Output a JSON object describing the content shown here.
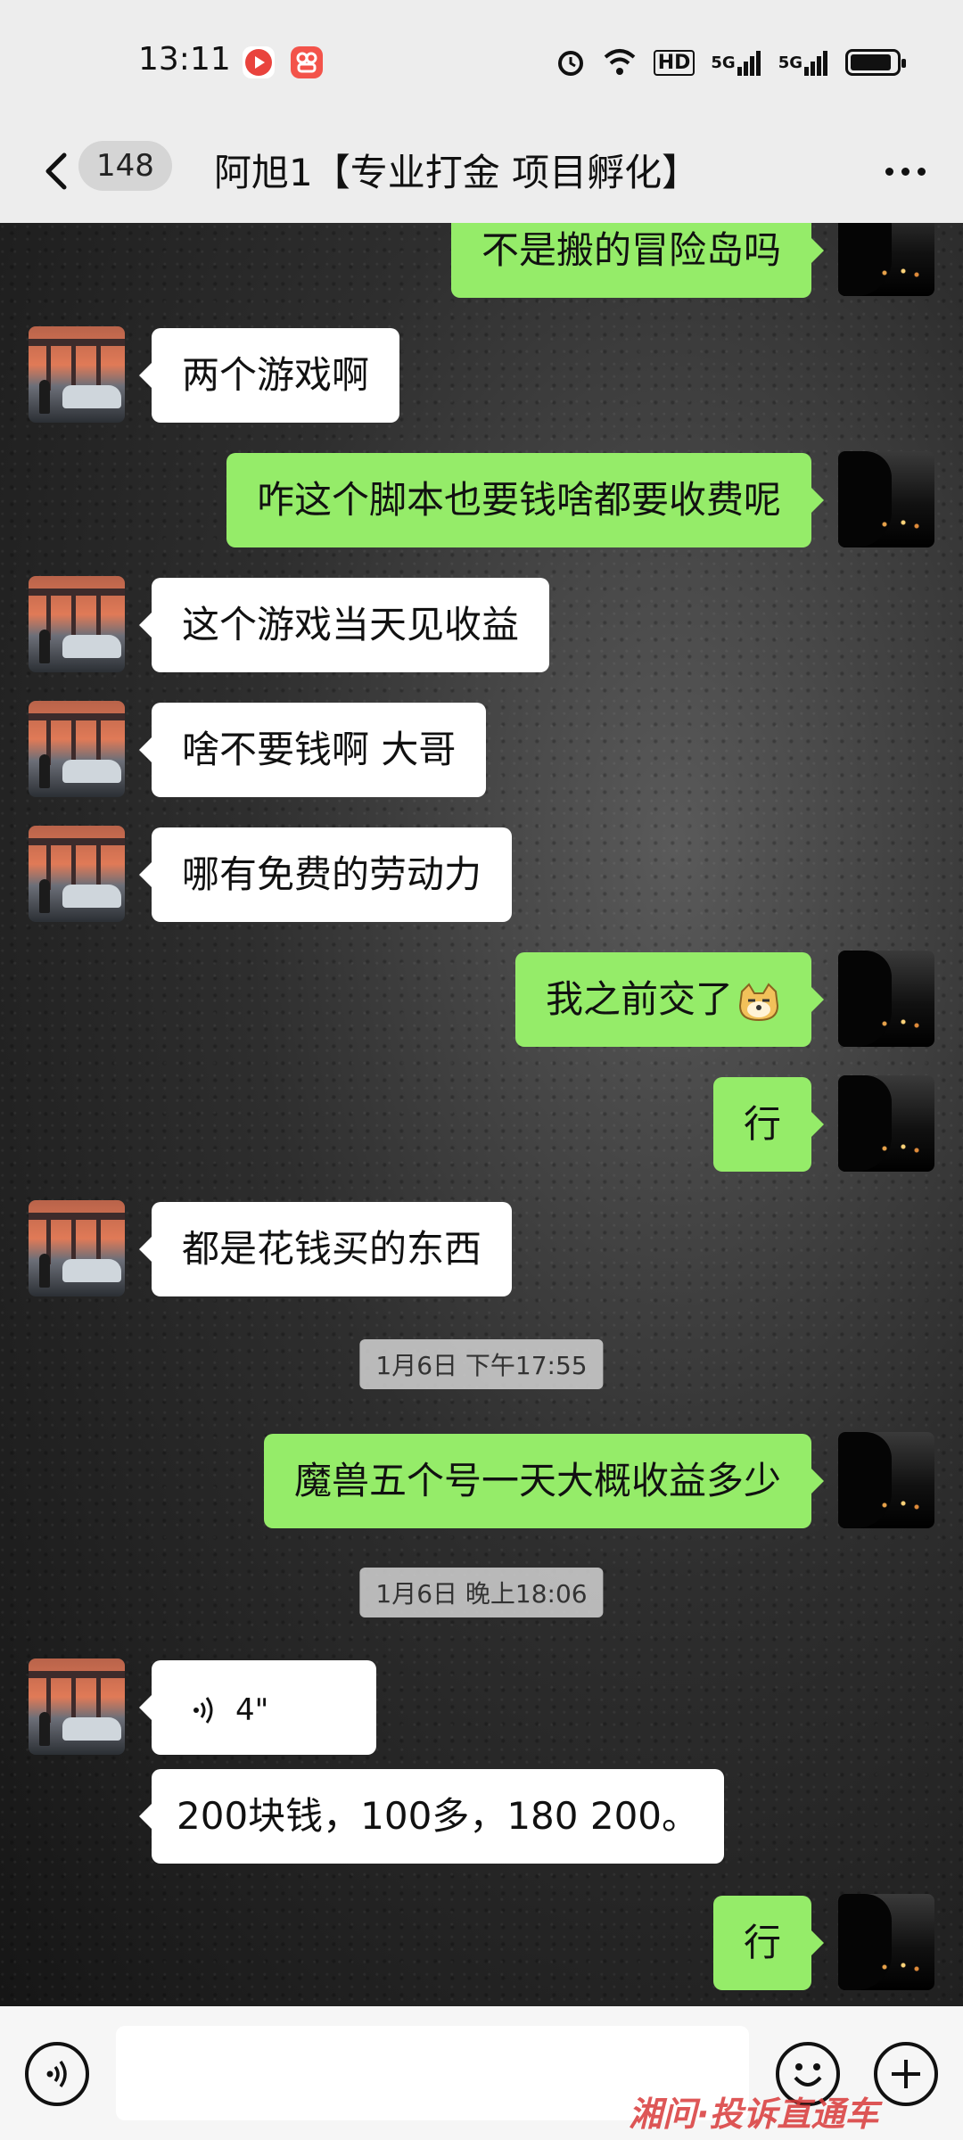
{
  "status_bar": {
    "time": "13:11",
    "icons": [
      "video-app-icon",
      "shopping-app-icon",
      "alarm-icon",
      "wifi-icon",
      "hd-icon",
      "signal-5g-icon",
      "signal-5g-icon-2",
      "battery-icon"
    ],
    "hd_label": "HD",
    "network_1": "5G",
    "network_2": "5G",
    "battery_level": 0.9,
    "app_colors": [
      "#e9433d",
      "#f3534a"
    ]
  },
  "header": {
    "unread_count": "148",
    "title": "阿旭1【专业打金 项目孵化】"
  },
  "messages": [
    {
      "side": "right",
      "text": "不是搬的冒险岛吗"
    },
    {
      "side": "left",
      "text": "两个游戏啊"
    },
    {
      "side": "right",
      "text": "咋这个脚本也要钱啥都要收费呢"
    },
    {
      "side": "left",
      "text": "这个游戏当天见收益"
    },
    {
      "side": "left",
      "text": "啥不要钱啊 大哥"
    },
    {
      "side": "left",
      "text": "哪有免费的劳动力"
    },
    {
      "side": "right",
      "text": "我之前交了",
      "emoji": "doge-emoji"
    },
    {
      "side": "right",
      "text": "行"
    },
    {
      "side": "left",
      "text": "都是花钱买的东西"
    },
    {
      "type": "time",
      "text": "1月6日 下午17:55"
    },
    {
      "side": "right",
      "text": "魔兽五个号一天大概收益多少"
    },
    {
      "type": "time",
      "text": "1月6日 晚上18:06"
    },
    {
      "side": "left",
      "type": "voice",
      "text": "4\""
    },
    {
      "side": "left",
      "text": "200块钱，100多，180 200。"
    },
    {
      "side": "right",
      "text": "行"
    }
  ],
  "colors": {
    "sent_bubble": "#95ec69",
    "received_bubble": "#ffffff",
    "watermark": "#d93a3a"
  },
  "input_bar": {
    "value": "",
    "watermark": "湘问·投诉直通车"
  }
}
